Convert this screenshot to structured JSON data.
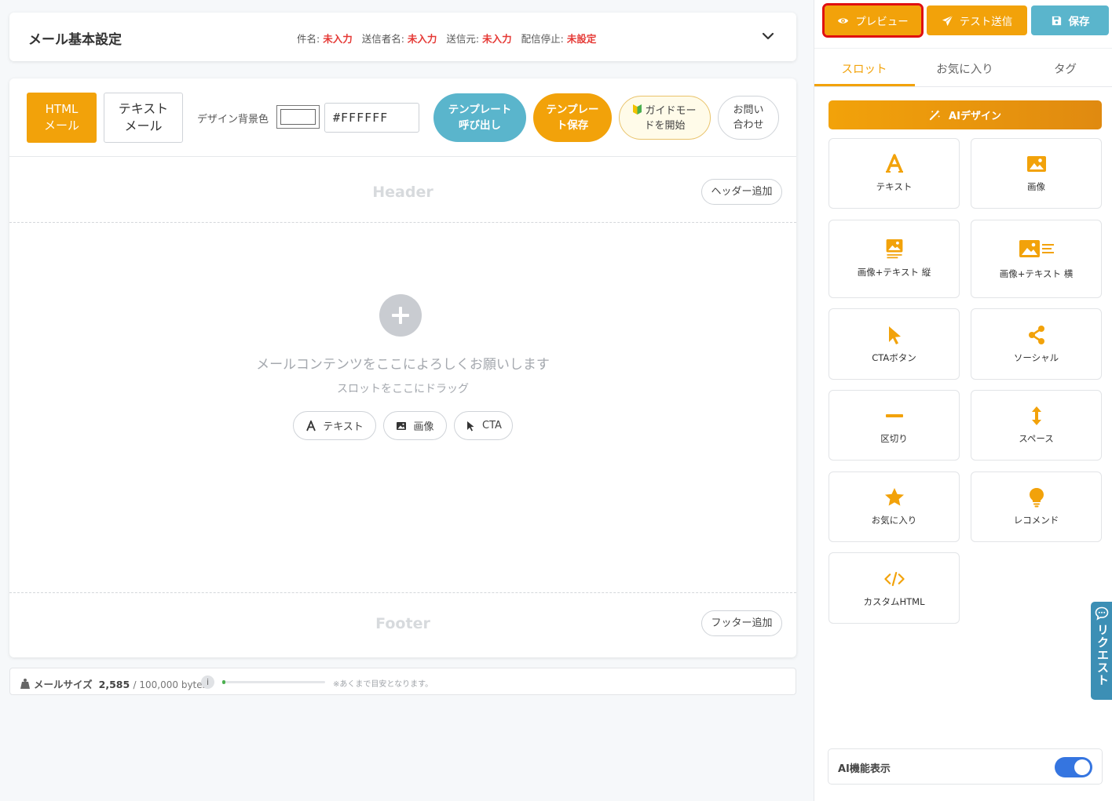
{
  "settings": {
    "title": "メール基本設定",
    "subject_key": "件名:",
    "subject_val": "未入力",
    "sender_name_key": "送信者名:",
    "sender_name_val": "未入力",
    "sender_from_key": "送信元:",
    "sender_from_val": "未入力",
    "unsubscribe_key": "配信停止:",
    "unsubscribe_val": "未設定"
  },
  "toolbar": {
    "html_line1": "HTML",
    "html_line2": "メール",
    "text_line1": "テキスト",
    "text_line2": "メール",
    "bg_color_label": "デザイン背景色",
    "bg_color_value": "#FFFFFF",
    "template_load_line1": "テンプレート",
    "template_load_line2": "呼び出し",
    "template_save_line1": "テンプレー",
    "template_save_line2": "ト保存",
    "guide_line1": "ガイドモー",
    "guide_line2": "ドを開始",
    "contact_line1": "お問い",
    "contact_line2": "合わせ"
  },
  "canvas": {
    "header_label": "Header",
    "add_header": "ヘッダー追加",
    "drop_message": "メールコンテンツをここによろしくお願いします",
    "drop_sub": "スロットをここにドラッグ",
    "quick_text": "テキスト",
    "quick_image": "画像",
    "quick_cta": "CTA",
    "footer_label": "Footer",
    "add_footer": "フッター追加"
  },
  "size": {
    "label": "メールサイズ",
    "current": "2,585",
    "total": "/ 100,000 bytes",
    "info": "i",
    "progress": 0.026,
    "note": "※あくまで目安となります。"
  },
  "header_buttons": {
    "preview": "プレビュー",
    "test_send": "テスト送信",
    "save": "保存"
  },
  "tabs": {
    "slot": "スロット",
    "favorites": "お気に入り",
    "tag": "タグ"
  },
  "ai_design": "AIデザイン",
  "tiles": {
    "text": "テキスト",
    "image": "画像",
    "image_text_vertical": "画像+テキスト 縦",
    "image_text_horizontal": "画像+テキスト 横",
    "cta_button": "CTAボタン",
    "social": "ソーシャル",
    "divider": "区切り",
    "space": "スペース",
    "favorite": "お気に入り",
    "recommend": "レコメンド",
    "custom_html": "カスタムHTML"
  },
  "ai_feature": {
    "label": "AI機能表示",
    "enabled": true
  },
  "request_tab": "リクエスト",
  "colors": {
    "accent": "#f2a20a",
    "teal": "#5ab5cc",
    "error": "#e53935",
    "toggle": "#3575e0"
  }
}
